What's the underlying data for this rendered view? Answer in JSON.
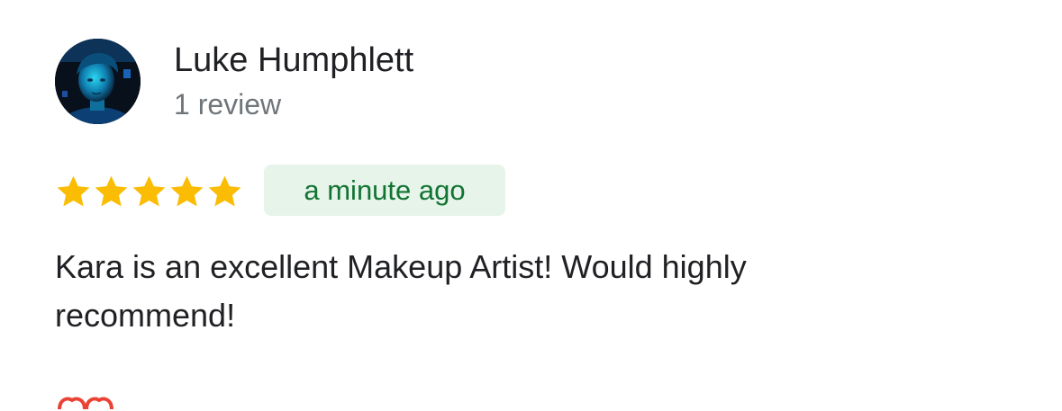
{
  "review": {
    "author_name": "Luke Humphlett",
    "review_count": "1 review",
    "rating": 5,
    "rating_max": 5,
    "time_ago": "a minute ago",
    "text": "Kara is an excellent Makeup Artist! Would highly recommend!"
  },
  "colors": {
    "star": "#fbbc04",
    "badge_bg": "#e6f4ea",
    "badge_text": "#137333",
    "primary_text": "#202124",
    "secondary_text": "#70757a",
    "peek_icon": "#ea4335"
  },
  "icons": {
    "avatar": "profile-photo",
    "star": "star-icon",
    "peek": "heart-icon"
  }
}
